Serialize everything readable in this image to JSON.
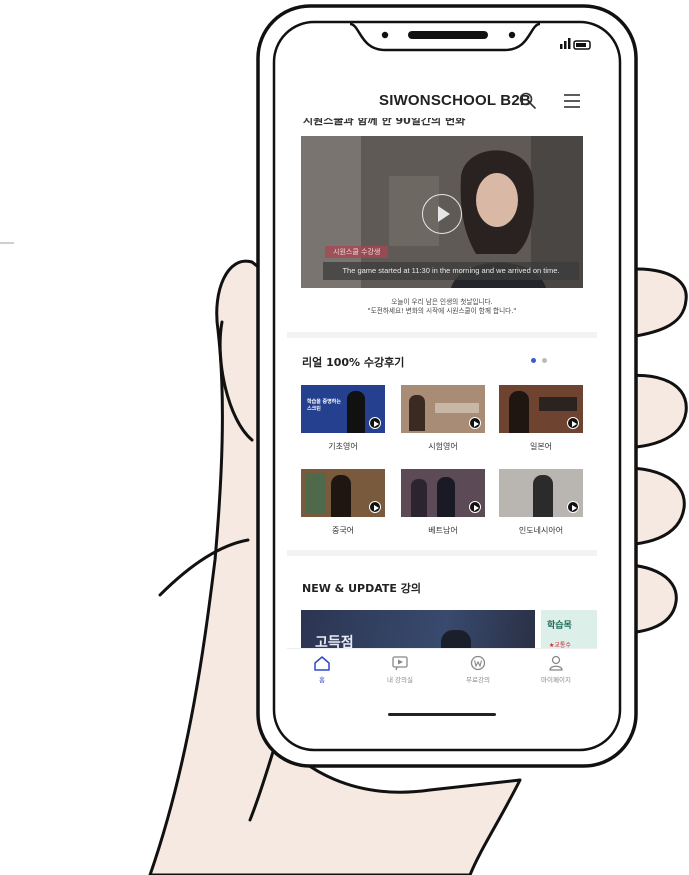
{
  "app": {
    "title": "SIWONSCHOOL B2B"
  },
  "hero": {
    "cut_title": "시원스쿨과 함께 한 90일간의 변화",
    "badge": "시원스쿨 수강생",
    "subtitle": "The game started at 11:30 in the morning and we arrived on time.",
    "caption_line1": "오늘이 우리 남은 인생의 첫날입니다.",
    "caption_line2": "\"도전하세요! 변화의 시작에 시원스쿨이 함께 합니다.\""
  },
  "reviews": {
    "title": "리얼 100% 수강후기",
    "page_count": 2,
    "active_page": 1,
    "items": [
      {
        "label": "기초영어",
        "thumb_text": "학습을 증명하는 스크린"
      },
      {
        "label": "시험영어"
      },
      {
        "label": "일본어"
      },
      {
        "label": "중국어"
      },
      {
        "label": "베트남어"
      },
      {
        "label": "인도네시아어"
      }
    ]
  },
  "new_update": {
    "title": "NEW & UPDATE 강의",
    "card1_text": "고득점",
    "card2_title": "학습목",
    "card2_sub": "★교통수"
  },
  "bottom_nav": [
    {
      "label": "홈",
      "icon": "home-icon",
      "active": true
    },
    {
      "label": "내 강의실",
      "icon": "my-classroom-icon",
      "active": false
    },
    {
      "label": "무료강의",
      "icon": "free-lecture-icon",
      "active": false
    },
    {
      "label": "마이페이지",
      "icon": "mypage-icon",
      "active": false
    }
  ],
  "colors": {
    "accent": "#2d49c8",
    "dot_inactive": "#bbbbbb",
    "skin": "#f6e9e1",
    "outline": "#111111"
  }
}
